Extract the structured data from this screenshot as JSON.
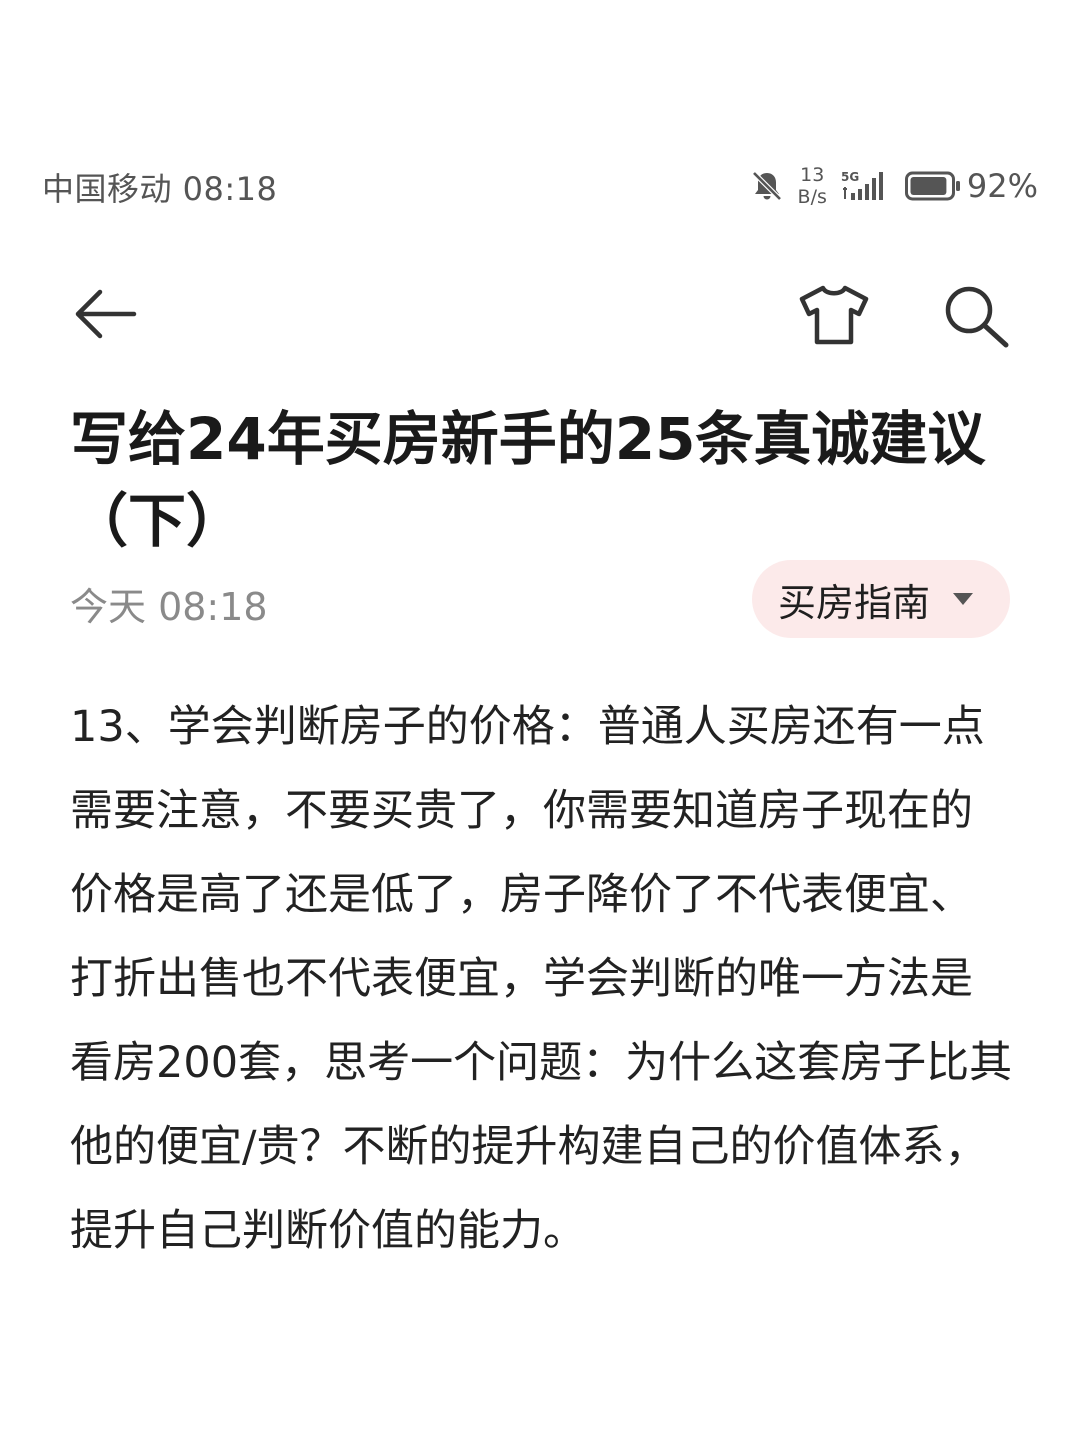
{
  "status_bar": {
    "carrier_time": "中国移动 08:18",
    "net_speed_value": "13",
    "net_speed_unit": "B/s",
    "network_type": "5G",
    "battery_percent": "92%",
    "battery_level": 0.92,
    "icons": [
      "bell-muted-icon",
      "signal-icon",
      "battery-icon"
    ]
  },
  "nav": {
    "icons": [
      "back-arrow-icon",
      "tshirt-icon",
      "search-icon"
    ]
  },
  "article": {
    "title": "写给24年买房新手的25条真诚建议（下）",
    "time": "今天 08:18",
    "category": "买房指南",
    "body": "13、学会判断房子的价格：普通人买房还有一点需要注意，不要买贵了，你需要知道房子现在的价格是高了还是低了，房子降价了不代表便宜、打折出售也不代表便宜，学会判断的唯一方法是看房200套，思考一个问题：为什么这套房子比其他的便宜/贵？不断的提升构建自己的价值体系，提升自己判断价值的能力。"
  },
  "colors": {
    "chip_background": "#fceaea",
    "meta_text": "#8a8a8a",
    "body_text": "#222222",
    "status_text": "#555555"
  }
}
